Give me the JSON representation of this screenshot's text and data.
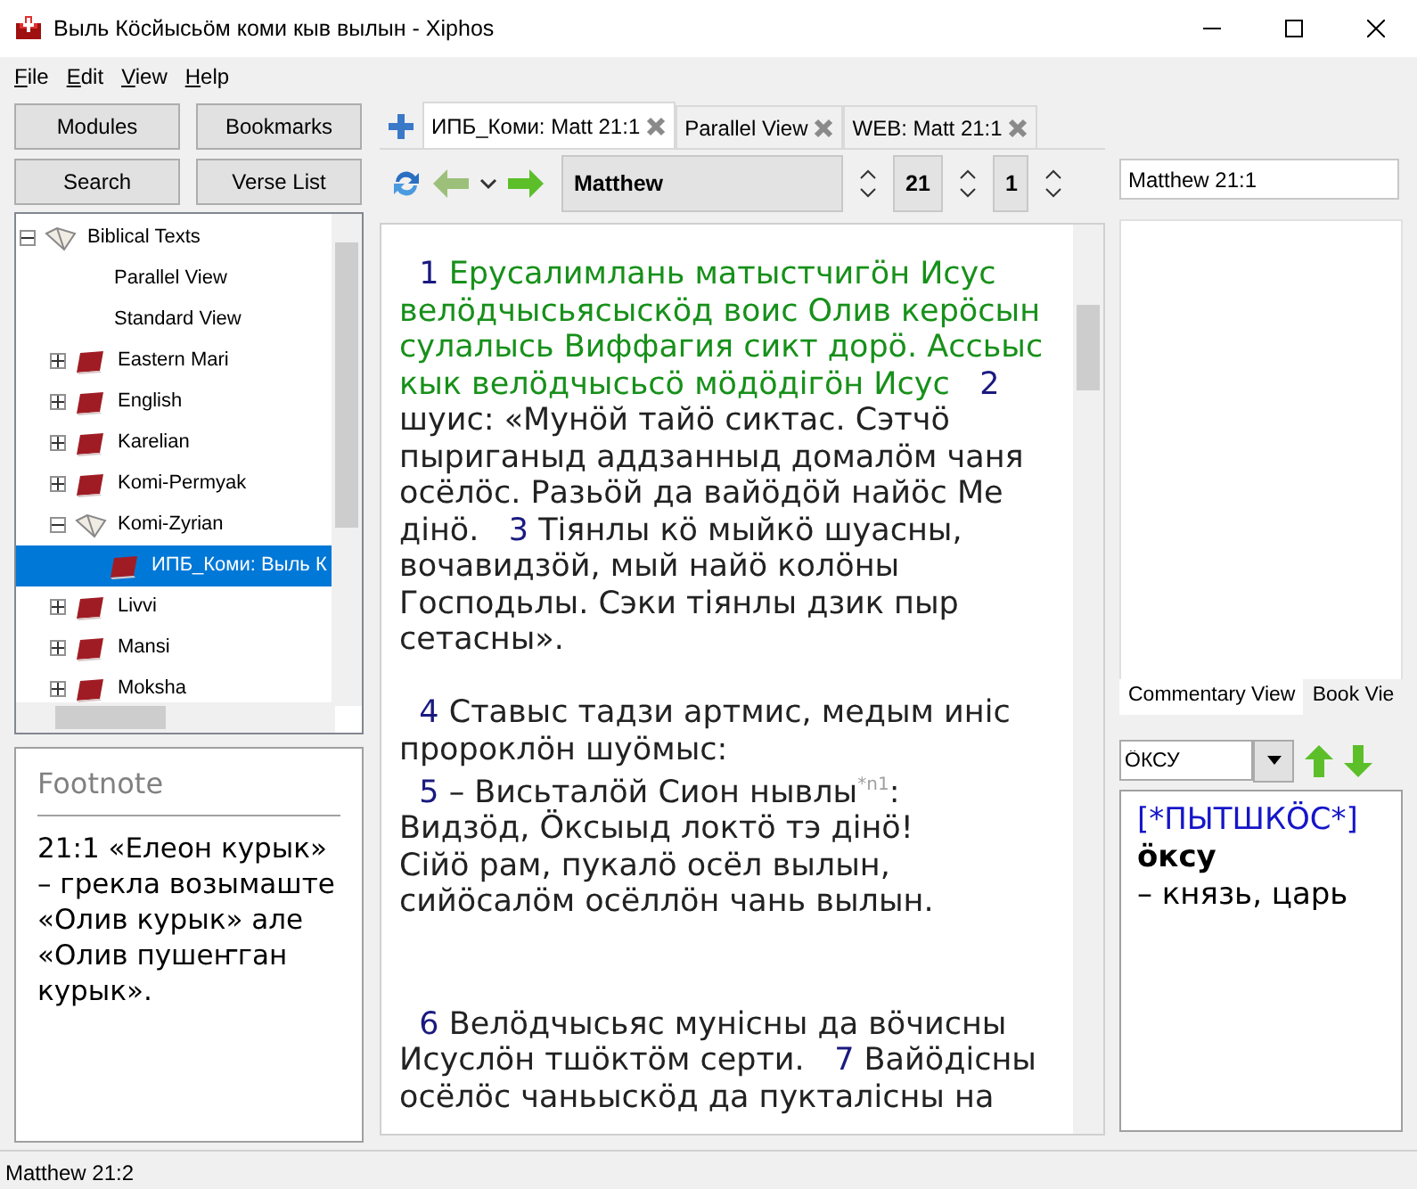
{
  "window": {
    "title": "Выль Кӧсйысьӧм коми кыв вылын - Xiphos"
  },
  "menu": [
    "File",
    "Edit",
    "View",
    "Help"
  ],
  "sidebar_buttons": [
    "Modules",
    "Bookmarks",
    "Search",
    "Verse List"
  ],
  "tree": [
    {
      "label": "Biblical Texts",
      "kind": "category",
      "expanded": true,
      "children": [
        {
          "label": "Parallel View",
          "kind": "view"
        },
        {
          "label": "Standard View",
          "kind": "view"
        },
        {
          "label": "Eastern Mari",
          "kind": "module",
          "expanded": false
        },
        {
          "label": "English",
          "kind": "module",
          "expanded": false
        },
        {
          "label": "Karelian",
          "kind": "module",
          "expanded": false
        },
        {
          "label": "Komi-Permyak",
          "kind": "module",
          "expanded": false
        },
        {
          "label": "Komi-Zyrian",
          "kind": "category",
          "expanded": true,
          "children": [
            {
              "label": "ИПБ_Коми: Выль К",
              "kind": "module",
              "selected": true
            }
          ]
        },
        {
          "label": "Livvi",
          "kind": "module",
          "expanded": false
        },
        {
          "label": "Mansi",
          "kind": "module",
          "expanded": false
        },
        {
          "label": "Moksha",
          "kind": "module",
          "expanded": false
        }
      ]
    }
  ],
  "footnote": {
    "title": "Footnote",
    "text": "21:1 «Елеон курык» – грекла возымаште «Олив курык» але «Олив пушеҥган курык»."
  },
  "tabs": [
    {
      "label": "ИПБ_Коми: Matt 21:1",
      "selected": true
    },
    {
      "label": "Parallel View",
      "selected": false
    },
    {
      "label": "WEB: Matt 21:1",
      "selected": false
    }
  ],
  "navigation": {
    "book": "Matthew",
    "chapter": "21",
    "verse": "1",
    "reference": "Matthew 21:1"
  },
  "passage": [
    {
      "verses": [
        {
          "number": "1",
          "current": true,
          "text": "Ерусалимлань матыстчигӧн Исус велӧдчысьясыскӧд воис Олив керӧсын сулалысь Виффагия сикт дорӧ. Ассьыс кык велӧдчысьсӧ мӧдӧдігӧн Исус"
        },
        {
          "number": "2",
          "current": false,
          "text": "шуис: «Мунӧй тайӧ сиктас. Сэтчӧ пыриганыд аддзанныд домалӧм чаня осёлӧс. Разьӧй да вайӧдӧй найӧс Ме дінӧ."
        },
        {
          "number": "3",
          "current": false,
          "text": "Тіянлы кӧ мыйкӧ шуасны, вочавидзӧй, мый найӧ колӧны Господьлы. Сэки тіянлы дзик пыр сетасны»."
        }
      ]
    },
    {
      "verses": [
        {
          "number": "4",
          "current": false,
          "text": "Ставыс тадзи артмис, медым иніс пророклӧн шуӧмыс:"
        },
        {
          "number": "5",
          "current": false,
          "text": "– Висьталӧй Сион нывлы",
          "footnote": "*n1",
          "after": ":",
          "poem": [
            "Видзӧд, Ӧксыыд локтӧ тэ дінӧ!",
            "Сійӧ рам, пукалӧ осёл вылын,",
            "сийӧсалӧм осёллӧн чань вылын."
          ]
        }
      ]
    },
    {
      "verses": [
        {
          "number": "6",
          "current": false,
          "text": "Велӧдчысьяс мунісны да вӧчисны Исуслӧн тшӧктӧм серти."
        },
        {
          "number": "7",
          "current": false,
          "text": "Вайӧдісны осёлӧс чаньыскӧд да пукталісны на"
        }
      ]
    }
  ],
  "side_tabs": [
    {
      "label": "Commentary View",
      "selected": true
    },
    {
      "label": "Book Vie",
      "selected": false
    }
  ],
  "dictionary": {
    "search": "ӦКСУ",
    "heading": "[*ПЫТШКӦС*]",
    "word": "ӧксу",
    "definition": "– князь, царь"
  },
  "status_bar": "Matthew 21:2"
}
